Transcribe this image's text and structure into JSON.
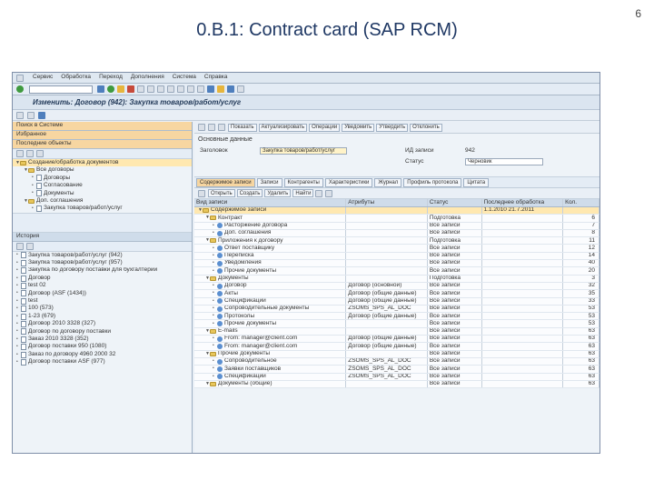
{
  "slide": {
    "title": "0.B.1: Contract card (SAP RCM)",
    "page_number": "6"
  },
  "sap": {
    "menu": [
      "Сервис",
      "Обработка",
      "Переход",
      "Дополнения",
      "Система",
      "Справка"
    ],
    "window_title": "Изменить: Договор (942): Закупка товаров/работ/услуг",
    "left_panel": {
      "headers": [
        "Поиск в Системе",
        "Избранное",
        "Последние объекты"
      ],
      "tree": [
        {
          "text": "Создание/обработка документов",
          "level": 0
        },
        {
          "text": "Все договоры",
          "level": 1
        },
        {
          "text": "Договоры",
          "level": 2
        },
        {
          "text": "Согласование",
          "level": 2
        },
        {
          "text": "Документы",
          "level": 2
        },
        {
          "text": "Доп. соглашения",
          "level": 1
        },
        {
          "text": "Закупка товаров/работ/услуг",
          "level": 2
        }
      ],
      "list_header": "История",
      "list_items": [
        "Закупка товаров/работ/услуг (942)",
        "Закупка товаров/работ/услуг (957)",
        "Закупка по договору поставки для бухгалтерии",
        "Договор",
        "test 02",
        "Договор (ASF (1434))",
        "test",
        "100 (573)",
        "1-23 (679)",
        "Договор 2010 3328 (327)",
        "Договор по договору поставки",
        "Заказ 2010 3328 (352)",
        "Договор поставки 950 (1080)",
        "Заказ по договору 4960 2000 32",
        "Договор поставки ASF (977)"
      ]
    },
    "right_panel": {
      "app_toolbar": [
        "Показать",
        "Актуализировать",
        "Операции",
        "Уведомить",
        "Утвердить",
        "Отклонить"
      ],
      "section_title": "Основные данные",
      "fields": {
        "contract_label": "Заголовок",
        "contract_value": "Закупка товаров/работ/услуг",
        "id_label": "ИД записи",
        "id_value": "942",
        "status_label": "Статус",
        "status_value": "Черновик"
      },
      "tabs": [
        "Содержимое записи",
        "Записи",
        "Контрагенты",
        "Характеристики",
        "Журнал",
        "Профиль протокола",
        "Цитата"
      ],
      "grid_toolbar": [
        "Открыть",
        "Создать",
        "Удалить",
        "Найти"
      ],
      "columns": [
        "Вид записи",
        "Атрибуты",
        "Статус",
        "Последнее обработка",
        "Кол."
      ],
      "rows": [
        {
          "text": "Содержимое записи",
          "level": 0,
          "attr": "",
          "status": "",
          "date": "1.1.2010 21.7.2011",
          "num": "",
          "sel": true
        },
        {
          "text": "Контракт",
          "level": 1,
          "attr": "",
          "status": "Подготовка",
          "date": "",
          "num": "6"
        },
        {
          "text": "Расторжение договора",
          "level": 2,
          "attr": "",
          "status": "Все записи",
          "date": "",
          "num": "7"
        },
        {
          "text": "Доп. соглашения",
          "level": 2,
          "attr": "",
          "status": "Все записи",
          "date": "",
          "num": "8"
        },
        {
          "text": "Приложения к договору",
          "level": 1,
          "attr": "",
          "status": "Подготовка",
          "date": "",
          "num": "11"
        },
        {
          "text": "Ответ поставщику",
          "level": 2,
          "attr": "",
          "status": "Все записи",
          "date": "",
          "num": "12"
        },
        {
          "text": "Переписка",
          "level": 2,
          "attr": "",
          "status": "Все записи",
          "date": "",
          "num": "14"
        },
        {
          "text": "Уведомления",
          "level": 2,
          "attr": "",
          "status": "Все записи",
          "date": "",
          "num": "40"
        },
        {
          "text": "Прочие документы",
          "level": 2,
          "attr": "",
          "status": "Все записи",
          "date": "",
          "num": "20"
        },
        {
          "text": "Документы",
          "level": 1,
          "attr": "",
          "status": "Подготовка",
          "date": "",
          "num": "3"
        },
        {
          "text": "Договор",
          "level": 2,
          "attr": "Договор (основной)",
          "status": "Все записи",
          "date": "",
          "num": "32"
        },
        {
          "text": "Акты",
          "level": 2,
          "attr": "Договор (общие данные)",
          "status": "Все записи",
          "date": "",
          "num": "35"
        },
        {
          "text": "Спецификации",
          "level": 2,
          "attr": "Договор (общие данные)",
          "status": "Все записи",
          "date": "",
          "num": "33"
        },
        {
          "text": "Сопроводительные документы",
          "level": 2,
          "attr": "ZSOMS_SPS_AL_DOC",
          "status": "Все записи",
          "date": "",
          "num": "53"
        },
        {
          "text": "Протоколы",
          "level": 2,
          "attr": "Договор (общие данные)",
          "status": "Все записи",
          "date": "",
          "num": "53"
        },
        {
          "text": "Прочие документы",
          "level": 2,
          "attr": "",
          "status": "Все записи",
          "date": "",
          "num": "53"
        },
        {
          "text": "E-mails",
          "level": 1,
          "attr": "",
          "status": "Все записи",
          "date": "",
          "num": "63"
        },
        {
          "text": "From: manager@client.com",
          "level": 2,
          "attr": "Договор (общие данные)",
          "status": "Все записи",
          "date": "",
          "num": "63"
        },
        {
          "text": "From: manager@client.com",
          "level": 2,
          "attr": "Договор (общие данные)",
          "status": "Все записи",
          "date": "",
          "num": "63"
        },
        {
          "text": "Прочие документы",
          "level": 1,
          "attr": "",
          "status": "Все записи",
          "date": "",
          "num": "63"
        },
        {
          "text": "Сопроводительное",
          "level": 2,
          "attr": "ZSOMS_SPS_AL_DOC",
          "status": "Все записи",
          "date": "",
          "num": "63"
        },
        {
          "text": "Заявки поставщиков",
          "level": 2,
          "attr": "ZSOMS_SPS_AL_DOC",
          "status": "Все записи",
          "date": "",
          "num": "63"
        },
        {
          "text": "Спецификации",
          "level": 2,
          "attr": "ZSOMS_SPS_AL_DOC",
          "status": "Все записи",
          "date": "",
          "num": "63"
        },
        {
          "text": "Документы (общие)",
          "level": 1,
          "attr": "",
          "status": "Все записи",
          "date": "",
          "num": "63"
        }
      ]
    }
  }
}
